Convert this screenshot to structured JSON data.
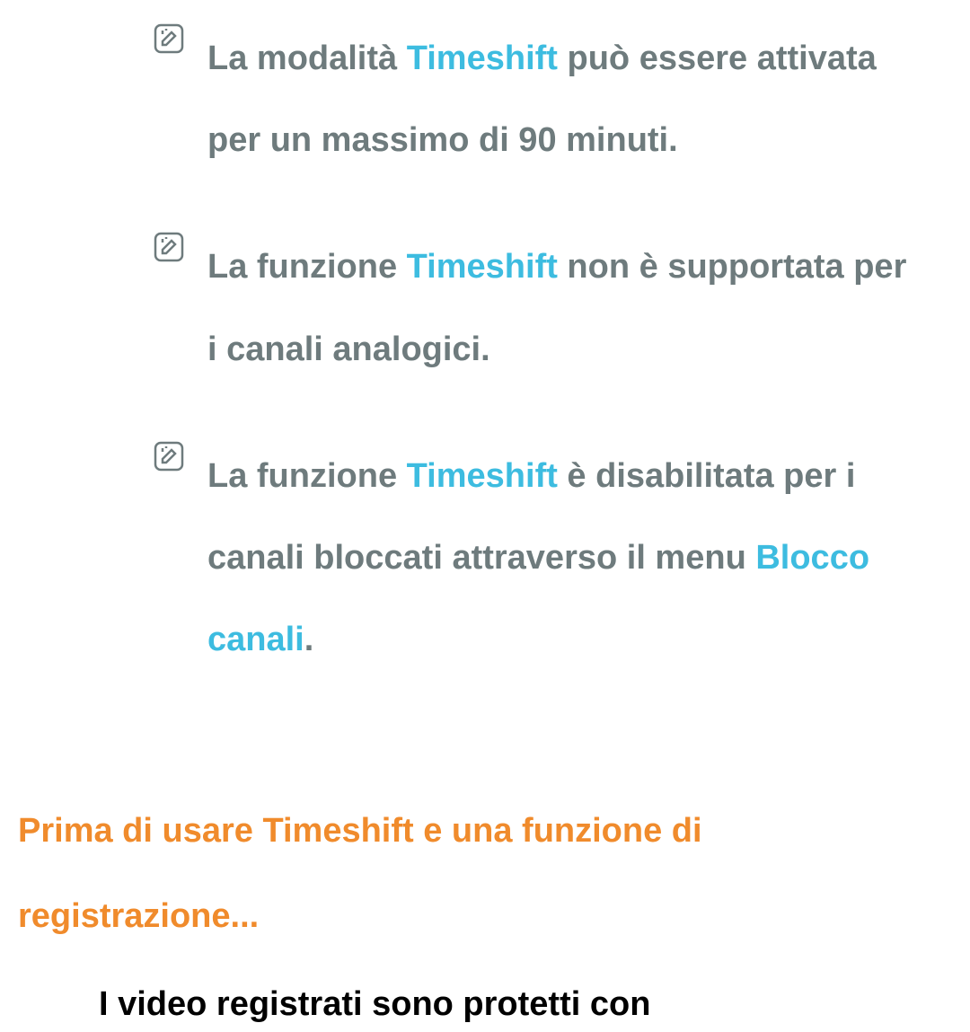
{
  "notes": [
    {
      "segments": [
        {
          "text": "La modalità ",
          "highlight": false
        },
        {
          "text": "Timeshift",
          "highlight": true
        },
        {
          "text": " può essere attivata per un massimo di 90 minuti.",
          "highlight": false
        }
      ]
    },
    {
      "segments": [
        {
          "text": "La funzione ",
          "highlight": false
        },
        {
          "text": "Timeshift",
          "highlight": true
        },
        {
          "text": " non è supportata per i canali analogici.",
          "highlight": false
        }
      ]
    },
    {
      "segments": [
        {
          "text": "La funzione ",
          "highlight": false
        },
        {
          "text": "Timeshift",
          "highlight": true
        },
        {
          "text": " è disabilitata per i canali bloccati attraverso il menu ",
          "highlight": false
        },
        {
          "text": "Blocco canali",
          "highlight": true
        },
        {
          "text": ".",
          "highlight": false
        }
      ]
    }
  ],
  "sectionHeading": "Prima di usare Timeshift e una funzione di registrazione...",
  "bodyText": "I video registrati sono protetti con"
}
